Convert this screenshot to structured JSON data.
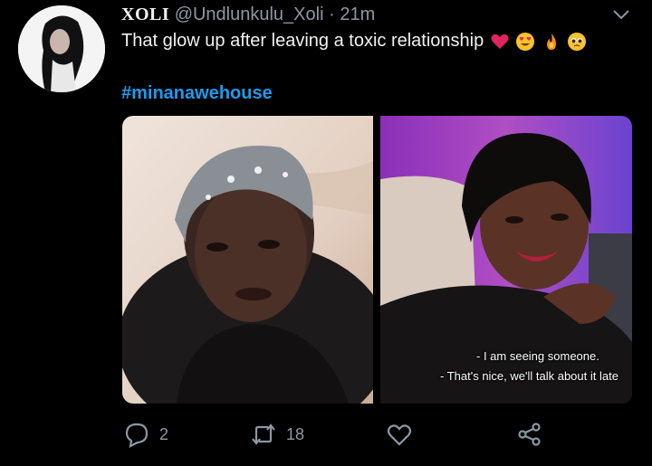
{
  "tweet": {
    "display_name": "XOLI",
    "handle": "@Undlunkulu_Xoli",
    "separator": "·",
    "time": "21m",
    "text": "That glow up after leaving a toxic relationship",
    "emojis": [
      "red-heart",
      "heart-eyes",
      "fire",
      "pleading-face"
    ],
    "hashtag": "#minanawehouse",
    "subtitle_line1": "- I am seeing someone.",
    "subtitle_line2": "- That's nice, we'll talk about it late",
    "replies": "2",
    "retweets": "18"
  },
  "colors": {
    "background": "#000000",
    "text": "#e7e9ea",
    "muted": "#8b98a5",
    "link": "#1d9bf0"
  }
}
